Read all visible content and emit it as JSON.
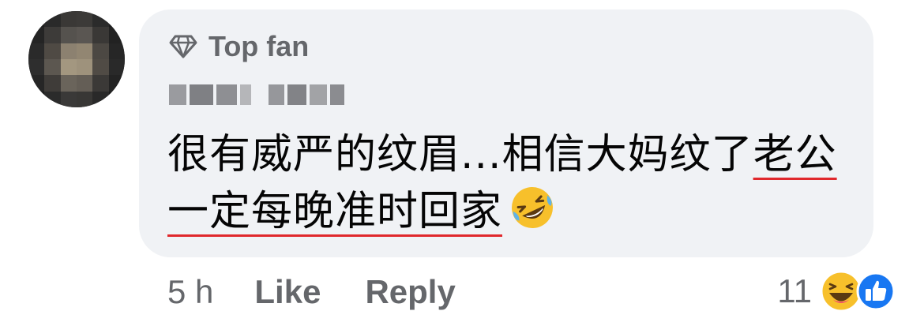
{
  "comment": {
    "badge_label": "Top fan",
    "badge_icon": "diamond-icon",
    "text_part1": "很有威严的纹眉...相信大妈纹了",
    "text_typo": "老公一定每晚准时回家",
    "emoji": "rolling-on-floor-laughing-emoji"
  },
  "actions": {
    "time": "5 h",
    "like_label": "Like",
    "reply_label": "Reply"
  },
  "reactions": {
    "count": "11",
    "icons": [
      "laughing-reaction-icon",
      "like-reaction-icon"
    ]
  },
  "colors": {
    "bubble": "#f0f2f5",
    "meta_text": "#65676b",
    "body_text": "#050505",
    "underline": "#e0282c",
    "like_blue": "#1877f2"
  }
}
